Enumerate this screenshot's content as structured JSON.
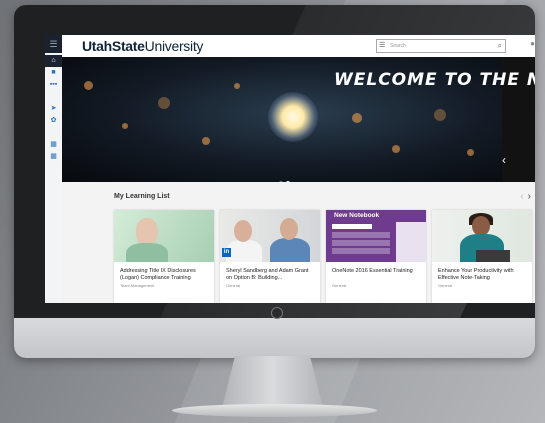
{
  "app": {
    "logo_bold": "UtahState",
    "logo_regular": "University"
  },
  "search": {
    "placeholder": "Search",
    "menu_icon": "menu-icon",
    "search_icon": "magnifier-icon"
  },
  "sidebar": {
    "items": [
      {
        "icon": "hamburger-icon"
      },
      {
        "icon": "home-icon"
      },
      {
        "icon": "book-icon"
      },
      {
        "icon": "grid-icon"
      },
      {
        "icon": "send-icon"
      },
      {
        "icon": "settings-icon"
      },
      {
        "icon": "calendar-icon"
      },
      {
        "icon": "calendar-icon"
      }
    ]
  },
  "hero": {
    "title": "WELCOME TO THE NEW I",
    "slides": 2,
    "active_slide": 2
  },
  "learning_list": {
    "title": "My Learning List",
    "cards": [
      {
        "title": "Addressing Title IX Disclosures (Logan) Compliance Training",
        "category": "Team Management"
      },
      {
        "title": "Sheryl Sandberg and Adam Grant on Option B: Building...",
        "category": "General",
        "badge": "in"
      },
      {
        "title": "OneNote 2016 Essential Training",
        "category": "General",
        "thumb_heading": "New Notebook"
      },
      {
        "title": "Enhance Your Productivity with Effective Note-Taking",
        "category": "General"
      }
    ]
  },
  "colors": {
    "topbar": "#ffffff",
    "sidebar_dark": "#1a2230",
    "accent": "#2c6fb3",
    "onenote": "#6f3b8f"
  }
}
